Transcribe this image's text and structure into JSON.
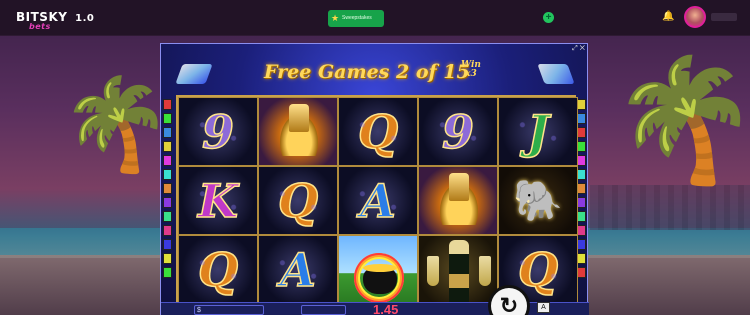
{
  "header": {
    "logo_text": "BITSKY",
    "logo_sub": "bets",
    "version": "1.0",
    "sweepstakes_label": "Sweepstakes",
    "colors": {
      "sweeps": "#17a34a",
      "accent": "#e0209a"
    }
  },
  "game": {
    "title": "Free Games 2 of 15",
    "win_multiplier_top": "Win",
    "win_multiplier_bottom": "x3",
    "current_win": "1.45",
    "reels": [
      [
        "9",
        "gold",
        "Q",
        "9",
        "J"
      ],
      [
        "K",
        "Q",
        "A",
        "gold",
        "elephant"
      ],
      [
        "Q",
        "A",
        "pot-of-gold",
        "champagne",
        "Q"
      ]
    ],
    "auto_label": "A",
    "spin_icon": "replay-icon"
  }
}
